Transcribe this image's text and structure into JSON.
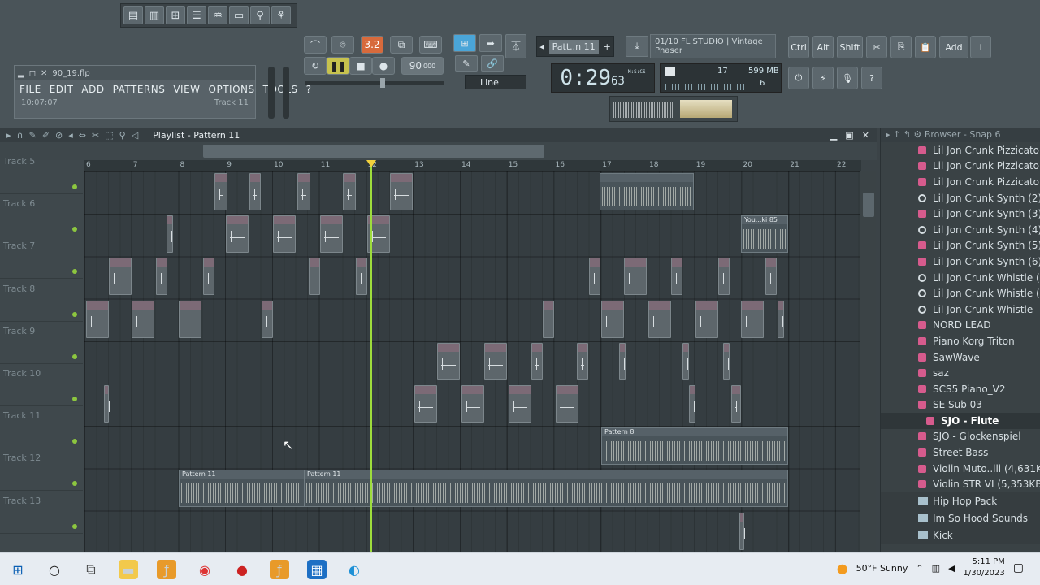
{
  "app": {
    "project_file": "90_19.flp",
    "menu": [
      "FILE",
      "EDIT",
      "ADD",
      "PATTERNS",
      "VIEW",
      "OPTIONS",
      "TOOLS",
      "?"
    ],
    "hint_time": "10:07:07",
    "hint_track": "Track 11"
  },
  "transport": {
    "pattern_mode": "3.2",
    "tempo": "90",
    "tempo_unit": "000",
    "pattern_name": "Patt..n 11",
    "snap": "Line",
    "time": "0:29",
    "time_ms": "63",
    "time_unit": "M:S:CS"
  },
  "hint_panel": {
    "line1": "01/10  FL STUDIO | Vintage",
    "line2": "Phaser"
  },
  "cpu": {
    "cores": "17",
    "memory": "599 MB",
    "polyphony": "6"
  },
  "right_toolbar": {
    "ctrl": "Ctrl",
    "alt": "Alt",
    "shift": "Shift",
    "add": "Add"
  },
  "playlist": {
    "title": "Playlist - Pattern 11",
    "ruler": [
      "6",
      "7",
      "8",
      "9",
      "10",
      "11",
      "12",
      "13",
      "14",
      "15",
      "16",
      "17",
      "18",
      "19",
      "20",
      "21",
      "22"
    ],
    "tracks": [
      "Track 5",
      "Track 6",
      "Track 7",
      "Track 8",
      "Track 9",
      "Track 10",
      "Track 11",
      "Track 12",
      "Track 13"
    ],
    "audio_clip_label": "You...ki 85",
    "pattern_8_label": "Pattern 8",
    "pattern_11_label": "Pattern 11"
  },
  "browser": {
    "title": "Browser - Snap 6",
    "items": [
      {
        "label": "Lil Jon Crunk Pizzicato (3)",
        "icon": "preset-icon"
      },
      {
        "label": "Lil Jon Crunk Pizzicato (4)",
        "icon": "preset-icon"
      },
      {
        "label": "Lil Jon Crunk Pizzicato",
        "icon": "preset-icon"
      },
      {
        "label": "Lil Jon Crunk Synth (2)",
        "icon": "gear-icon"
      },
      {
        "label": "Lil Jon Crunk Synth (3)",
        "icon": "preset-icon"
      },
      {
        "label": "Lil Jon Crunk Synth (4)",
        "icon": "gear-icon"
      },
      {
        "label": "Lil Jon Crunk Synth (5)",
        "icon": "preset-icon"
      },
      {
        "label": "Lil Jon Crunk Synth (6)",
        "icon": "preset-icon"
      },
      {
        "label": "Lil Jon Crunk Whistle (2)",
        "icon": "gear-icon"
      },
      {
        "label": "Lil Jon Crunk Whistle (3)",
        "icon": "gear-icon"
      },
      {
        "label": "Lil Jon Crunk Whistle",
        "icon": "gear-icon"
      },
      {
        "label": "NORD LEAD",
        "icon": "preset-icon"
      },
      {
        "label": "Piano Korg Triton",
        "icon": "preset-icon"
      },
      {
        "label": "SawWave",
        "icon": "preset-icon"
      },
      {
        "label": "saz",
        "icon": "preset-icon"
      },
      {
        "label": "SCS5 Piano_V2",
        "icon": "preset-icon"
      },
      {
        "label": "SE Sub 03",
        "icon": "preset-icon"
      },
      {
        "label": "SJO - Flute",
        "icon": "preset-icon",
        "selected": true
      },
      {
        "label": "SJO - Glockenspiel",
        "icon": "preset-icon"
      },
      {
        "label": "Street Bass",
        "icon": "preset-icon"
      },
      {
        "label": "Violin Muto..lli (4,631KB)",
        "icon": "preset-icon"
      },
      {
        "label": "Violin STR VI (5,353KB)",
        "icon": "preset-icon"
      }
    ],
    "folders": [
      "Hip Hop Pack",
      "Im So Hood Sounds",
      "Kick"
    ]
  },
  "taskbar": {
    "weather": "50°F  Sunny",
    "time": "5:11 PM",
    "date": "1/30/2023"
  },
  "colors": {
    "accent_orange": "#d76a3c",
    "playhead_green": "#9edd3c",
    "browser_pink": "#d65b8d"
  }
}
